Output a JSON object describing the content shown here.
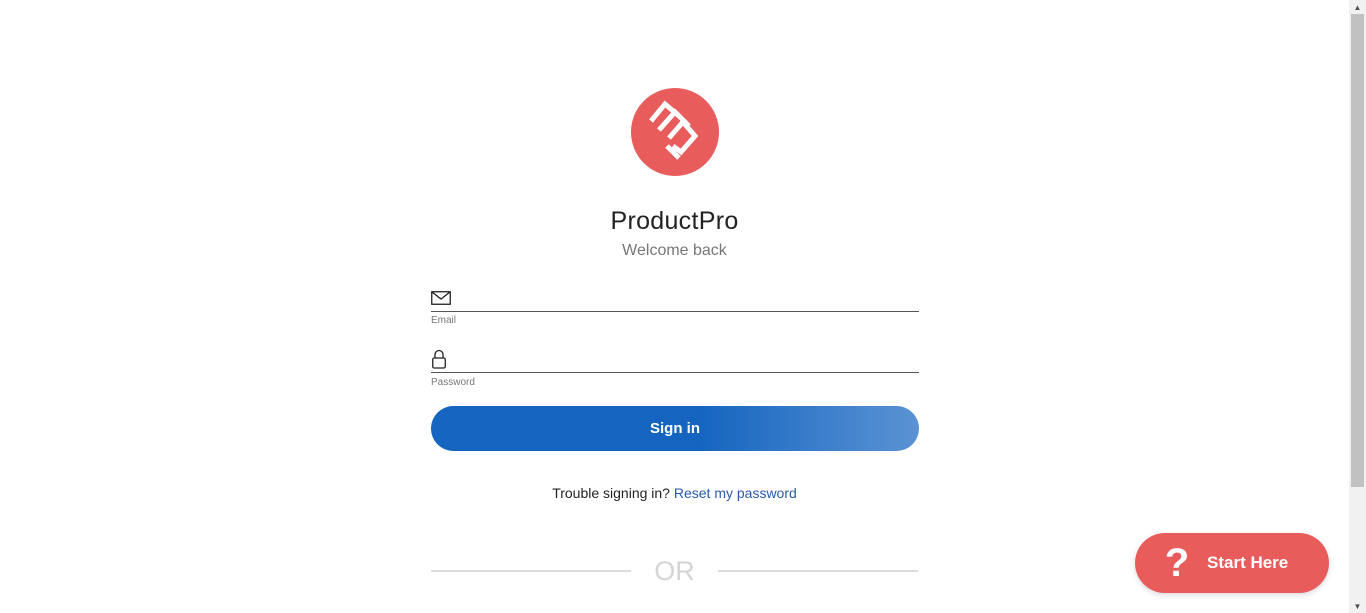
{
  "brand": {
    "name": "ProductPro",
    "subtitle": "Welcome back",
    "logo_color": "#e85c5c"
  },
  "form": {
    "email": {
      "label": "Email",
      "value": "",
      "icon": "mail-icon"
    },
    "password": {
      "label": "Password",
      "value": "",
      "icon": "lock-icon"
    },
    "submit_label": "Sign in",
    "submit_color": "#1565c0"
  },
  "help": {
    "prefix": "Trouble signing in?",
    "link": "Reset my password"
  },
  "divider": {
    "label": "OR"
  },
  "floating": {
    "icon": "?",
    "label": "Start Here",
    "color": "#e85c5c"
  }
}
